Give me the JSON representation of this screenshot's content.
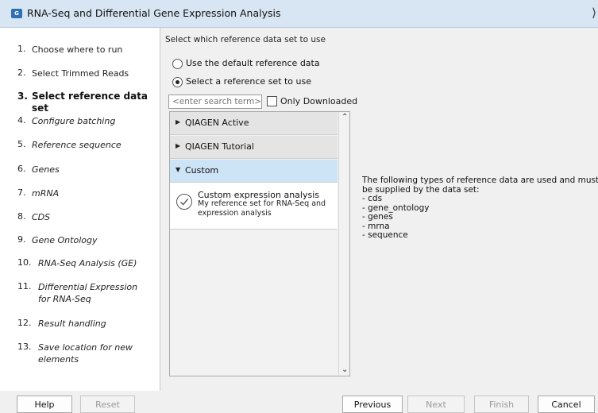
{
  "window": {
    "title": "RNA-Seq and Differential Gene Expression Analysis",
    "icon_text": "G"
  },
  "steps": [
    {
      "num": "1.",
      "label": "Choose where to run"
    },
    {
      "num": "2.",
      "label": "Select Trimmed Reads"
    },
    {
      "num": "3.",
      "label": "Select reference data set"
    },
    {
      "num": "4.",
      "label": "Configure batching"
    },
    {
      "num": "5.",
      "label": "Reference sequence"
    },
    {
      "num": "6.",
      "label": "Genes"
    },
    {
      "num": "7.",
      "label": "mRNA"
    },
    {
      "num": "8.",
      "label": "CDS"
    },
    {
      "num": "9.",
      "label": "Gene Ontology"
    },
    {
      "num": "10.",
      "label": "RNA-Seq Analysis (GE)"
    },
    {
      "num": "11.",
      "label_line1": "Differential Expression",
      "label_line2": "for RNA-Seq"
    },
    {
      "num": "12.",
      "label": "Result handling"
    },
    {
      "num": "13.",
      "label_line1": "Save location for new",
      "label_line2": "elements"
    }
  ],
  "main": {
    "heading": "Select which reference data set to use",
    "option_default": "Use the default reference data",
    "option_select": "Select a reference set to use",
    "search_placeholder": "<enter search term>",
    "only_downloaded": "Only Downloaded",
    "groups": [
      {
        "label": "QIAGEN Active"
      },
      {
        "label": "QIAGEN Tutorial"
      },
      {
        "label": "Custom"
      }
    ],
    "item": {
      "title": "Custom expression analysis",
      "description": "My reference set for RNA-Seq and expression analysis"
    },
    "info_lines": [
      "The following types of reference data are used and must",
      "be supplied by the data set:",
      "- cds",
      "- gene_ontology",
      "- genes",
      "- mrna",
      "- sequence"
    ]
  },
  "buttons": {
    "help": "Help",
    "reset": "Reset",
    "previous": "Previous",
    "next": "Next",
    "finish": "Finish",
    "cancel": "Cancel"
  }
}
